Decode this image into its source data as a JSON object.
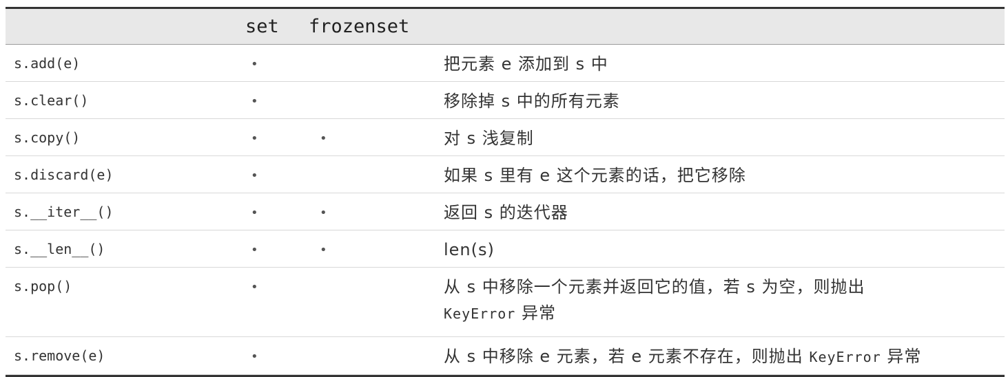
{
  "header": {
    "col_set": "set",
    "col_frozenset": "frozenset"
  },
  "rows": [
    {
      "method": "s.add(e)",
      "set": "•",
      "frozenset": "",
      "description": "把元素 e 添加到 s 中"
    },
    {
      "method": "s.clear()",
      "set": "•",
      "frozenset": "",
      "description": "移除掉 s 中的所有元素"
    },
    {
      "method": "s.copy()",
      "set": "•",
      "frozenset": "•",
      "description": "对 s 浅复制"
    },
    {
      "method": "s.discard(e)",
      "set": "•",
      "frozenset": "",
      "description": "如果 s 里有 e 这个元素的话，把它移除"
    },
    {
      "method": "s.__iter__()",
      "set": "•",
      "frozenset": "•",
      "description": "返回 s 的迭代器"
    },
    {
      "method": "s.__len__()",
      "set": "•",
      "frozenset": "•",
      "description": "len(s)"
    },
    {
      "method": "s.pop()",
      "set": "•",
      "frozenset": "",
      "description_line1": "从 s 中移除一个元素并返回它的值，若 s 为空，则抛出",
      "description_line2_code": "KeyError",
      "description_line2_text": " 异常"
    },
    {
      "method": "s.remove(e)",
      "set": "•",
      "frozenset": "",
      "description_text": "从 s 中移除 e 元素，若 e 元素不存在，则抛出 ",
      "description_code": "KeyError",
      "description_tail": " 异常"
    }
  ]
}
